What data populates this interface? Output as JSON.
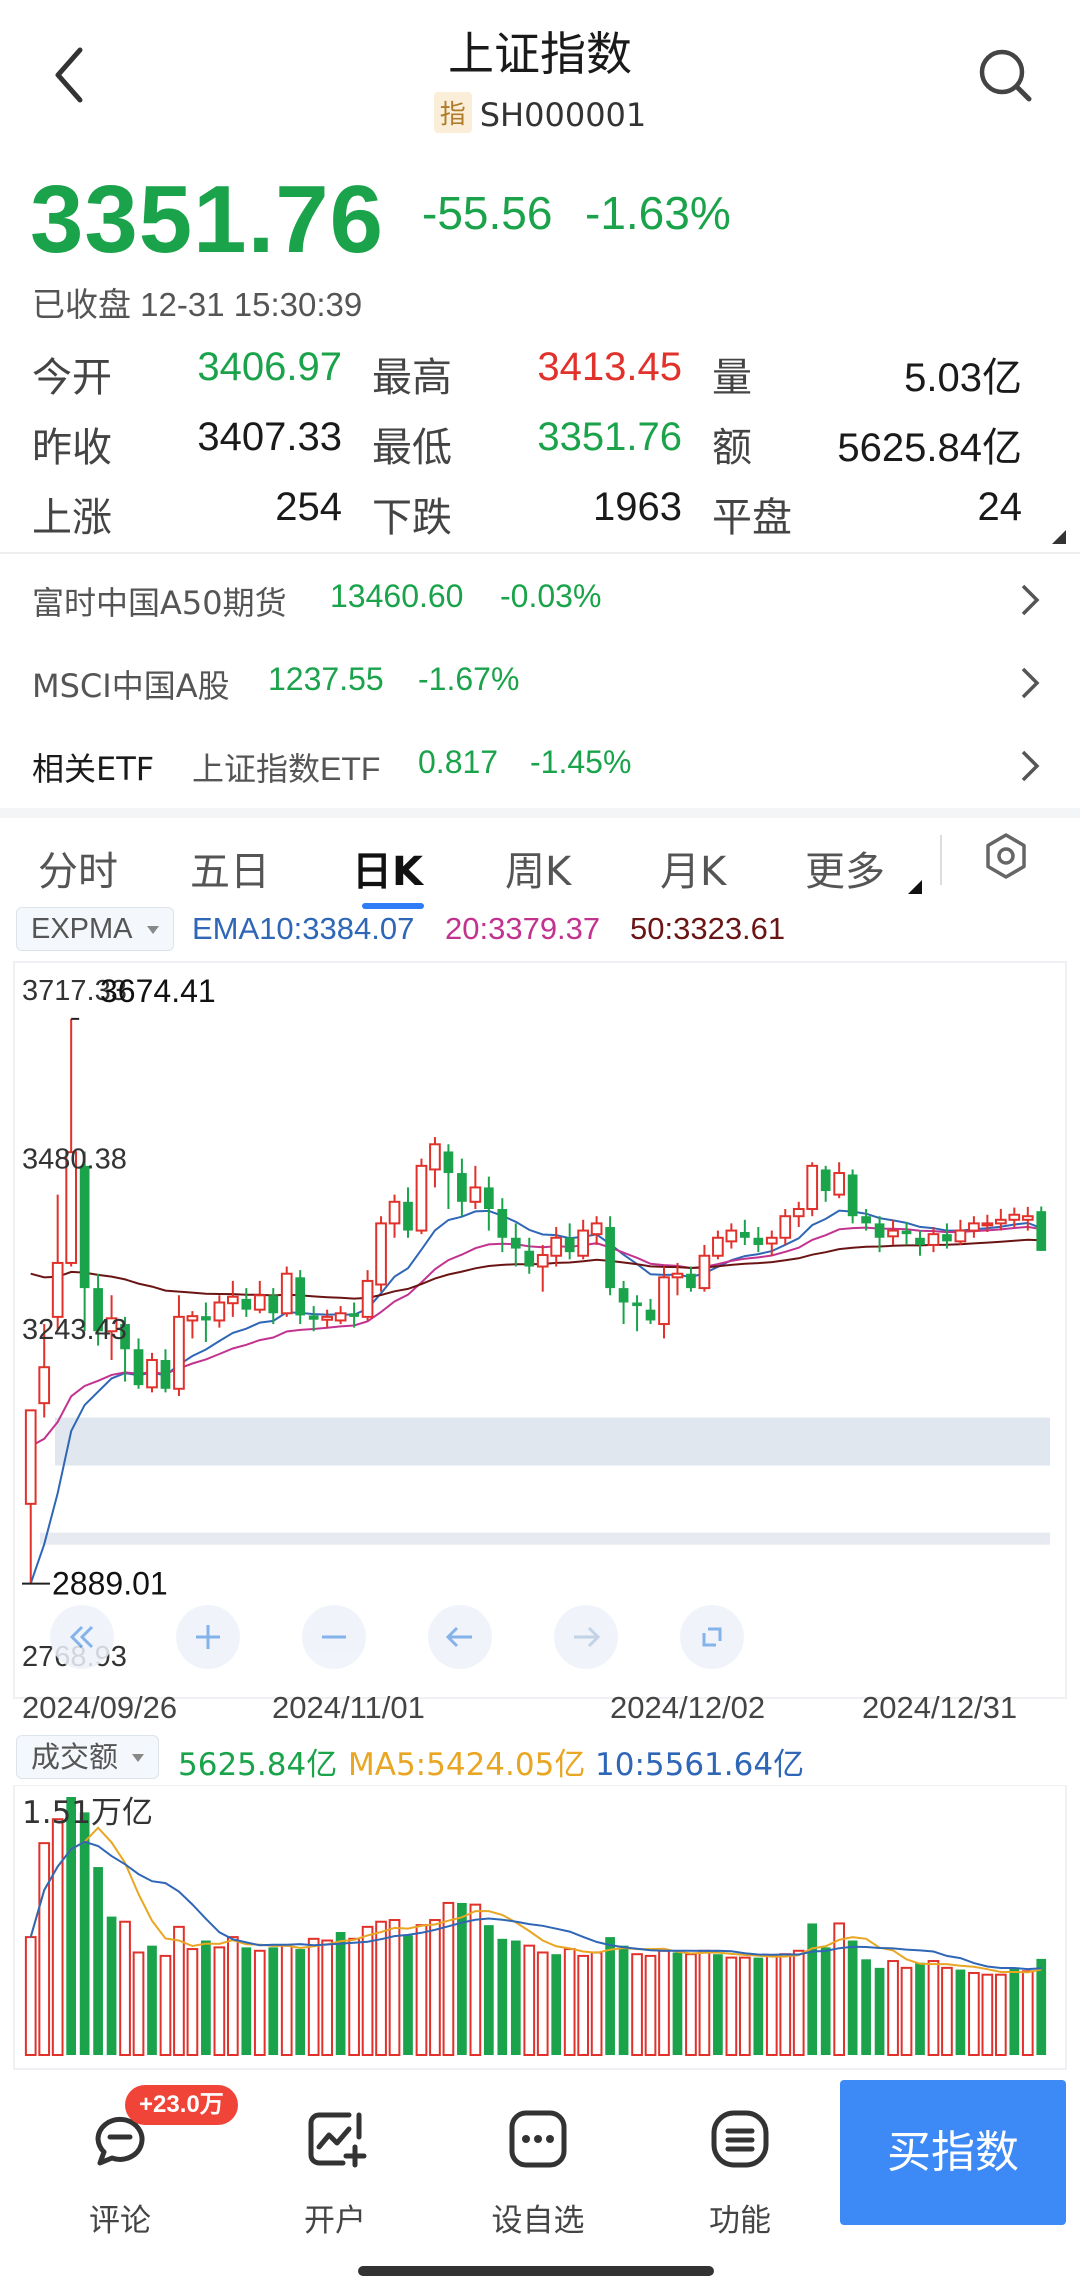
{
  "header": {
    "title": "上证指数",
    "code_tag": "指",
    "code": "SH000001"
  },
  "quote": {
    "price": "3351.76",
    "change": "-55.56",
    "change_pct": "-1.63%",
    "status": "已收盘 12-31 15:30:39",
    "grid": [
      {
        "l1": "今开",
        "v1": "3406.97",
        "c1": "green",
        "l2": "最高",
        "v2": "3413.45",
        "c2": "red",
        "l3": "量",
        "v3": "5.03亿",
        "c3": "dark"
      },
      {
        "l1": "昨收",
        "v1": "3407.33",
        "c1": "dark",
        "l2": "最低",
        "v2": "3351.76",
        "c2": "green",
        "l3": "额",
        "v3": "5625.84亿",
        "c3": "dark"
      },
      {
        "l1": "上涨",
        "v1": "254",
        "c1": "dark",
        "l2": "下跌",
        "v2": "1963",
        "c2": "dark",
        "l3": "平盘",
        "v3": "24",
        "c3": "dark"
      }
    ]
  },
  "related": [
    {
      "name": "富时中国A50期货",
      "value": "13460.60",
      "pct": "-0.03%"
    },
    {
      "name": "MSCI中国A股",
      "value": "1237.55",
      "pct": "-1.67%"
    },
    {
      "name": "相关ETF",
      "sub": "上证指数ETF",
      "value": "0.817",
      "pct": "-1.45%"
    }
  ],
  "tabs": [
    "分时",
    "五日",
    "日K",
    "周K",
    "月K",
    "更多"
  ],
  "active_tab": "日K",
  "kline_indicator": {
    "name": "EXPMA",
    "ema10": "EMA10:3384.07",
    "ema20": "20:3379.37",
    "ema50": "50:3323.61"
  },
  "colors": {
    "up": "#e0312b",
    "down": "#1aa34a",
    "ema10": "#2f66b6",
    "ema20": "#c2338f",
    "ema50": "#6a1414",
    "ma5_vol": "#e8a623",
    "ma10_vol": "#2f66b6",
    "accent": "#3d8af7"
  },
  "chart_data": [
    {
      "type": "candlestick",
      "title": "",
      "y_labels": [
        "3717.33",
        "3480.38",
        "3243.43"
      ],
      "high_label": "3674.41",
      "low_label": "2889.01",
      "bottom_label": "2768.93",
      "x_labels": [
        "2024/09/26",
        "2024/11/01",
        "2024/12/02",
        "2024/12/31"
      ],
      "ylim": [
        2768.93,
        3717.33
      ],
      "candles": [
        [
          3000,
          3130,
          3130,
          2889.01
        ],
        [
          3140,
          3190,
          3250,
          3120
        ],
        [
          3260,
          3335,
          3430,
          3240
        ],
        [
          3335,
          3489,
          3674.41,
          3330
        ],
        [
          3470,
          3300,
          3490,
          3240
        ],
        [
          3300,
          3240,
          3320,
          3220
        ],
        [
          3240,
          3258,
          3290,
          3200
        ],
        [
          3250,
          3215,
          3260,
          3170
        ],
        [
          3215,
          3165,
          3230,
          3160
        ],
        [
          3162,
          3200,
          3210,
          3155
        ],
        [
          3200,
          3160,
          3215,
          3155
        ],
        [
          3160,
          3260,
          3290,
          3150
        ],
        [
          3255,
          3261,
          3268,
          3230
        ],
        [
          3261,
          3255,
          3280,
          3225
        ],
        [
          3255,
          3280,
          3290,
          3245
        ],
        [
          3279,
          3288,
          3310,
          3260
        ],
        [
          3285,
          3270,
          3300,
          3260
        ],
        [
          3270,
          3290,
          3310,
          3265
        ],
        [
          3290,
          3265,
          3300,
          3250
        ],
        [
          3265,
          3320,
          3330,
          3260
        ],
        [
          3315,
          3262,
          3325,
          3250
        ],
        [
          3262,
          3256,
          3275,
          3240
        ],
        [
          3256,
          3260,
          3270,
          3245
        ],
        [
          3255,
          3265,
          3275,
          3250
        ],
        [
          3265,
          3260,
          3280,
          3245
        ],
        [
          3260,
          3310,
          3325,
          3255
        ],
        [
          3305,
          3390,
          3400,
          3295
        ],
        [
          3390,
          3420,
          3430,
          3370
        ],
        [
          3420,
          3380,
          3440,
          3370
        ],
        [
          3380,
          3470,
          3480,
          3375
        ],
        [
          3465,
          3500,
          3510,
          3440
        ],
        [
          3490,
          3460,
          3500,
          3410
        ],
        [
          3460,
          3420,
          3480,
          3400
        ],
        [
          3420,
          3440,
          3470,
          3410
        ],
        [
          3440,
          3410,
          3455,
          3380
        ],
        [
          3410,
          3370,
          3425,
          3350
        ],
        [
          3370,
          3355,
          3390,
          3330
        ],
        [
          3352,
          3330,
          3370,
          3320
        ],
        [
          3330,
          3346,
          3360,
          3295
        ],
        [
          3345,
          3370,
          3385,
          3330
        ],
        [
          3370,
          3350,
          3390,
          3340
        ],
        [
          3345,
          3380,
          3395,
          3340
        ],
        [
          3375,
          3390,
          3400,
          3360
        ],
        [
          3385,
          3300,
          3400,
          3290
        ],
        [
          3300,
          3280,
          3310,
          3250
        ],
        [
          3280,
          3275,
          3290,
          3240
        ],
        [
          3270,
          3255,
          3285,
          3250
        ],
        [
          3250,
          3315,
          3330,
          3230
        ],
        [
          3315,
          3320,
          3335,
          3290
        ],
        [
          3320,
          3300,
          3330,
          3295
        ],
        [
          3300,
          3345,
          3360,
          3295
        ],
        [
          3345,
          3370,
          3380,
          3340
        ],
        [
          3365,
          3380,
          3390,
          3355
        ],
        [
          3378,
          3370,
          3395,
          3360
        ],
        [
          3370,
          3360,
          3385,
          3350
        ],
        [
          3362,
          3370,
          3380,
          3345
        ],
        [
          3370,
          3400,
          3410,
          3360
        ],
        [
          3400,
          3410,
          3420,
          3385
        ],
        [
          3410,
          3470,
          3475,
          3400
        ],
        [
          3465,
          3435,
          3470,
          3420
        ],
        [
          3430,
          3460,
          3475,
          3425
        ],
        [
          3458,
          3400,
          3465,
          3390
        ],
        [
          3400,
          3390,
          3410,
          3380
        ],
        [
          3390,
          3370,
          3400,
          3350
        ],
        [
          3372,
          3380,
          3395,
          3360
        ],
        [
          3380,
          3375,
          3392,
          3360
        ],
        [
          3370,
          3360,
          3380,
          3345
        ],
        [
          3360,
          3375,
          3385,
          3350
        ],
        [
          3375,
          3365,
          3390,
          3355
        ],
        [
          3365,
          3380,
          3395,
          3360
        ],
        [
          3380,
          3390,
          3400,
          3370
        ],
        [
          3390,
          3390,
          3402,
          3378
        ],
        [
          3390,
          3395,
          3410,
          3380
        ],
        [
          3395,
          3402,
          3412,
          3385
        ],
        [
          3395,
          3400,
          3413,
          3380
        ],
        [
          3406.97,
          3351.76,
          3413.45,
          3351.76
        ]
      ],
      "ema_start": [
        2889.01,
        3080,
        3320
      ]
    },
    {
      "type": "bar",
      "title": "",
      "indicator": "成交额",
      "amount": "5625.84亿",
      "ma5": "MA5:5424.05亿",
      "ma10": "10:5561.64亿",
      "y_label": "1.51万亿",
      "ylim": [
        0,
        15100
      ],
      "values": [
        6900,
        12400,
        13800,
        15100,
        14200,
        11000,
        8100,
        7800,
        6000,
        6400,
        5800,
        7500,
        6200,
        6700,
        6300,
        6900,
        6300,
        6100,
        6300,
        6400,
        6200,
        6800,
        6700,
        7200,
        6800,
        7500,
        7800,
        7900,
        7000,
        7600,
        7900,
        8900,
        8900,
        8800,
        7600,
        6800,
        6700,
        6400,
        6000,
        5900,
        6200,
        5800,
        6000,
        6900,
        6400,
        5900,
        5800,
        6100,
        6000,
        5900,
        6100,
        5900,
        5700,
        5700,
        5700,
        5800,
        5900,
        6100,
        7700,
        6300,
        7700,
        6700,
        5600,
        5100,
        5500,
        5100,
        5400,
        5500,
        5100,
        5000,
        4800,
        4700,
        4700,
        5100,
        4900,
        5626
      ],
      "colors_up": [
        true,
        true,
        true,
        false,
        false,
        false,
        false,
        true,
        true,
        false,
        true,
        true,
        true,
        false,
        true,
        true,
        false,
        true,
        false,
        true,
        false,
        true,
        true,
        false,
        true,
        true,
        true,
        true,
        false,
        true,
        true,
        true,
        false,
        true,
        false,
        false,
        false,
        true,
        true,
        false,
        true,
        true,
        true,
        false,
        false,
        true,
        true,
        true,
        false,
        true,
        true,
        false,
        true,
        true,
        false,
        true,
        true,
        true,
        false,
        false,
        true,
        false,
        false,
        false,
        true,
        true,
        false,
        true,
        true,
        false,
        true,
        true,
        true,
        false,
        true,
        false
      ]
    }
  ],
  "bottom": {
    "badge": "+23.0万",
    "items": [
      "评论",
      "开户",
      "设自选",
      "功能"
    ],
    "buy": "买指数"
  }
}
